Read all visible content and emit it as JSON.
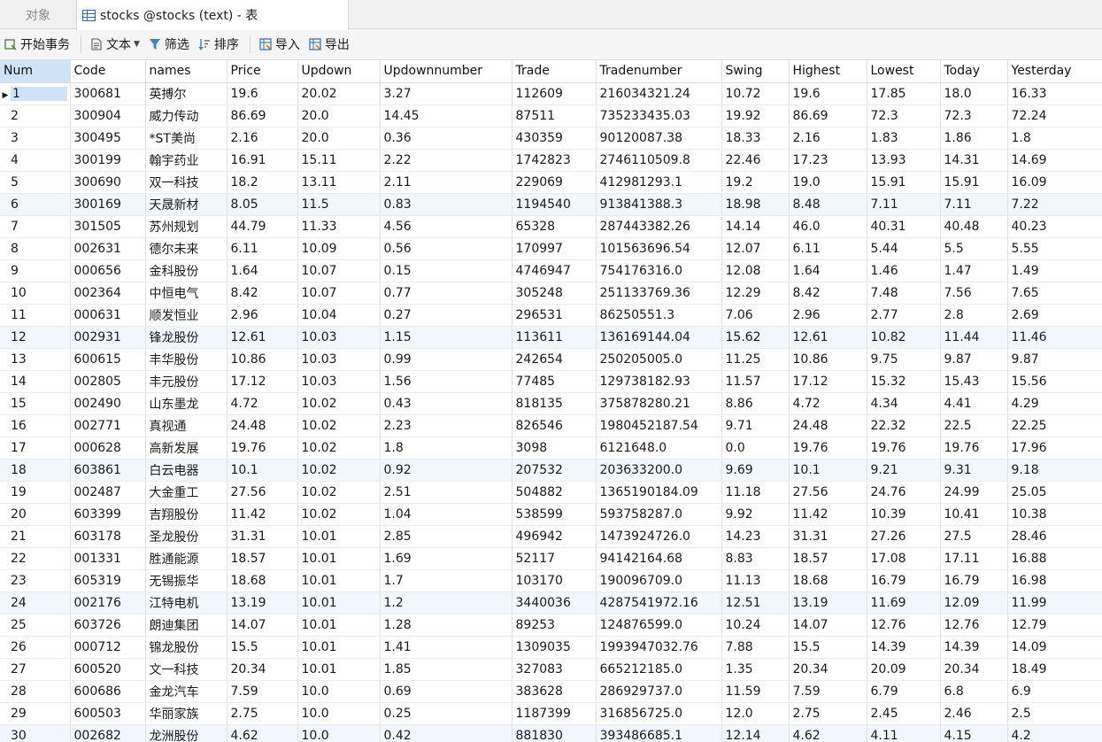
{
  "tabs": {
    "inactive": "对象",
    "active": "stocks @stocks (text) - 表"
  },
  "toolbar": {
    "begin": "开始事务",
    "text": "文本",
    "filter": "筛选",
    "sort": "排序",
    "import": "导入",
    "export": "导出"
  },
  "columns": [
    "Num",
    "Code",
    "names",
    "Price",
    "Updown",
    "Updownnumber",
    "Trade",
    "Tradenumber",
    "Swing",
    "Highest",
    "Lowest",
    "Today",
    "Yesterday"
  ],
  "rows": [
    [
      "1",
      "300681",
      "英搏尔",
      "19.6",
      "20.02",
      "3.27",
      "112609",
      "216034321.24",
      "10.72",
      "19.6",
      "17.85",
      "18.0",
      "16.33"
    ],
    [
      "2",
      "300904",
      "威力传动",
      "86.69",
      "20.0",
      "14.45",
      "87511",
      "735233435.03",
      "19.92",
      "86.69",
      "72.3",
      "72.3",
      "72.24"
    ],
    [
      "3",
      "300495",
      "*ST美尚",
      "2.16",
      "20.0",
      "0.36",
      "430359",
      "90120087.38",
      "18.33",
      "2.16",
      "1.83",
      "1.86",
      "1.8"
    ],
    [
      "4",
      "300199",
      "翰宇药业",
      "16.91",
      "15.11",
      "2.22",
      "1742823",
      "2746110509.8",
      "22.46",
      "17.23",
      "13.93",
      "14.31",
      "14.69"
    ],
    [
      "5",
      "300690",
      "双一科技",
      "18.2",
      "13.11",
      "2.11",
      "229069",
      "412981293.1",
      "19.2",
      "19.0",
      "15.91",
      "15.91",
      "16.09"
    ],
    [
      "6",
      "300169",
      "天晟新材",
      "8.05",
      "11.5",
      "0.83",
      "1194540",
      "913841388.3",
      "18.98",
      "8.48",
      "7.11",
      "7.11",
      "7.22"
    ],
    [
      "7",
      "301505",
      "苏州规划",
      "44.79",
      "11.33",
      "4.56",
      "65328",
      "287443382.26",
      "14.14",
      "46.0",
      "40.31",
      "40.48",
      "40.23"
    ],
    [
      "8",
      "002631",
      "德尔未来",
      "6.11",
      "10.09",
      "0.56",
      "170997",
      "101563696.54",
      "12.07",
      "6.11",
      "5.44",
      "5.5",
      "5.55"
    ],
    [
      "9",
      "000656",
      "金科股份",
      "1.64",
      "10.07",
      "0.15",
      "4746947",
      "754176316.0",
      "12.08",
      "1.64",
      "1.46",
      "1.47",
      "1.49"
    ],
    [
      "10",
      "002364",
      "中恒电气",
      "8.42",
      "10.07",
      "0.77",
      "305248",
      "251133769.36",
      "12.29",
      "8.42",
      "7.48",
      "7.56",
      "7.65"
    ],
    [
      "11",
      "000631",
      "顺发恒业",
      "2.96",
      "10.04",
      "0.27",
      "296531",
      "86250551.3",
      "7.06",
      "2.96",
      "2.77",
      "2.8",
      "2.69"
    ],
    [
      "12",
      "002931",
      "锋龙股份",
      "12.61",
      "10.03",
      "1.15",
      "113611",
      "136169144.04",
      "15.62",
      "12.61",
      "10.82",
      "11.44",
      "11.46"
    ],
    [
      "13",
      "600615",
      "丰华股份",
      "10.86",
      "10.03",
      "0.99",
      "242654",
      "250205005.0",
      "11.25",
      "10.86",
      "9.75",
      "9.87",
      "9.87"
    ],
    [
      "14",
      "002805",
      "丰元股份",
      "17.12",
      "10.03",
      "1.56",
      "77485",
      "129738182.93",
      "11.57",
      "17.12",
      "15.32",
      "15.43",
      "15.56"
    ],
    [
      "15",
      "002490",
      "山东墨龙",
      "4.72",
      "10.02",
      "0.43",
      "818135",
      "375878280.21",
      "8.86",
      "4.72",
      "4.34",
      "4.41",
      "4.29"
    ],
    [
      "16",
      "002771",
      "真视通",
      "24.48",
      "10.02",
      "2.23",
      "826546",
      "1980452187.54",
      "9.71",
      "24.48",
      "22.32",
      "22.5",
      "22.25"
    ],
    [
      "17",
      "000628",
      "高新发展",
      "19.76",
      "10.02",
      "1.8",
      "3098",
      "6121648.0",
      "0.0",
      "19.76",
      "19.76",
      "19.76",
      "17.96"
    ],
    [
      "18",
      "603861",
      "白云电器",
      "10.1",
      "10.02",
      "0.92",
      "207532",
      "203633200.0",
      "9.69",
      "10.1",
      "9.21",
      "9.31",
      "9.18"
    ],
    [
      "19",
      "002487",
      "大金重工",
      "27.56",
      "10.02",
      "2.51",
      "504882",
      "1365190184.09",
      "11.18",
      "27.56",
      "24.76",
      "24.99",
      "25.05"
    ],
    [
      "20",
      "603399",
      "吉翔股份",
      "11.42",
      "10.02",
      "1.04",
      "538599",
      "593758287.0",
      "9.92",
      "11.42",
      "10.39",
      "10.41",
      "10.38"
    ],
    [
      "21",
      "603178",
      "圣龙股份",
      "31.31",
      "10.01",
      "2.85",
      "496942",
      "1473924726.0",
      "14.23",
      "31.31",
      "27.26",
      "27.5",
      "28.46"
    ],
    [
      "22",
      "001331",
      "胜通能源",
      "18.57",
      "10.01",
      "1.69",
      "52117",
      "94142164.68",
      "8.83",
      "18.57",
      "17.08",
      "17.11",
      "16.88"
    ],
    [
      "23",
      "605319",
      "无锡振华",
      "18.68",
      "10.01",
      "1.7",
      "103170",
      "190096709.0",
      "11.13",
      "18.68",
      "16.79",
      "16.79",
      "16.98"
    ],
    [
      "24",
      "002176",
      "江特电机",
      "13.19",
      "10.01",
      "1.2",
      "3440036",
      "4287541972.16",
      "12.51",
      "13.19",
      "11.69",
      "12.09",
      "11.99"
    ],
    [
      "25",
      "603726",
      "朗迪集团",
      "14.07",
      "10.01",
      "1.28",
      "89253",
      "124876599.0",
      "10.24",
      "14.07",
      "12.76",
      "12.76",
      "12.79"
    ],
    [
      "26",
      "000712",
      "锦龙股份",
      "15.5",
      "10.01",
      "1.41",
      "1309035",
      "1993947032.76",
      "7.88",
      "15.5",
      "14.39",
      "14.39",
      "14.09"
    ],
    [
      "27",
      "600520",
      "文一科技",
      "20.34",
      "10.01",
      "1.85",
      "327083",
      "665212185.0",
      "1.35",
      "20.34",
      "20.09",
      "20.34",
      "18.49"
    ],
    [
      "28",
      "600686",
      "金龙汽车",
      "7.59",
      "10.0",
      "0.69",
      "383628",
      "286929737.0",
      "11.59",
      "7.59",
      "6.79",
      "6.8",
      "6.9"
    ],
    [
      "29",
      "600503",
      "华丽家族",
      "2.75",
      "10.0",
      "0.25",
      "1187399",
      "316856725.0",
      "12.0",
      "2.75",
      "2.45",
      "2.46",
      "2.5"
    ],
    [
      "30",
      "002682",
      "龙洲股份",
      "4.62",
      "10.0",
      "0.42",
      "881830",
      "393486685.1",
      "12.14",
      "4.62",
      "4.11",
      "4.15",
      "4.2"
    ]
  ],
  "current_row_indicator": "▶",
  "colors": {
    "selection": "#cfe3f7",
    "alt_row": "#f2f7fd",
    "accent": "#2b6cb0"
  }
}
